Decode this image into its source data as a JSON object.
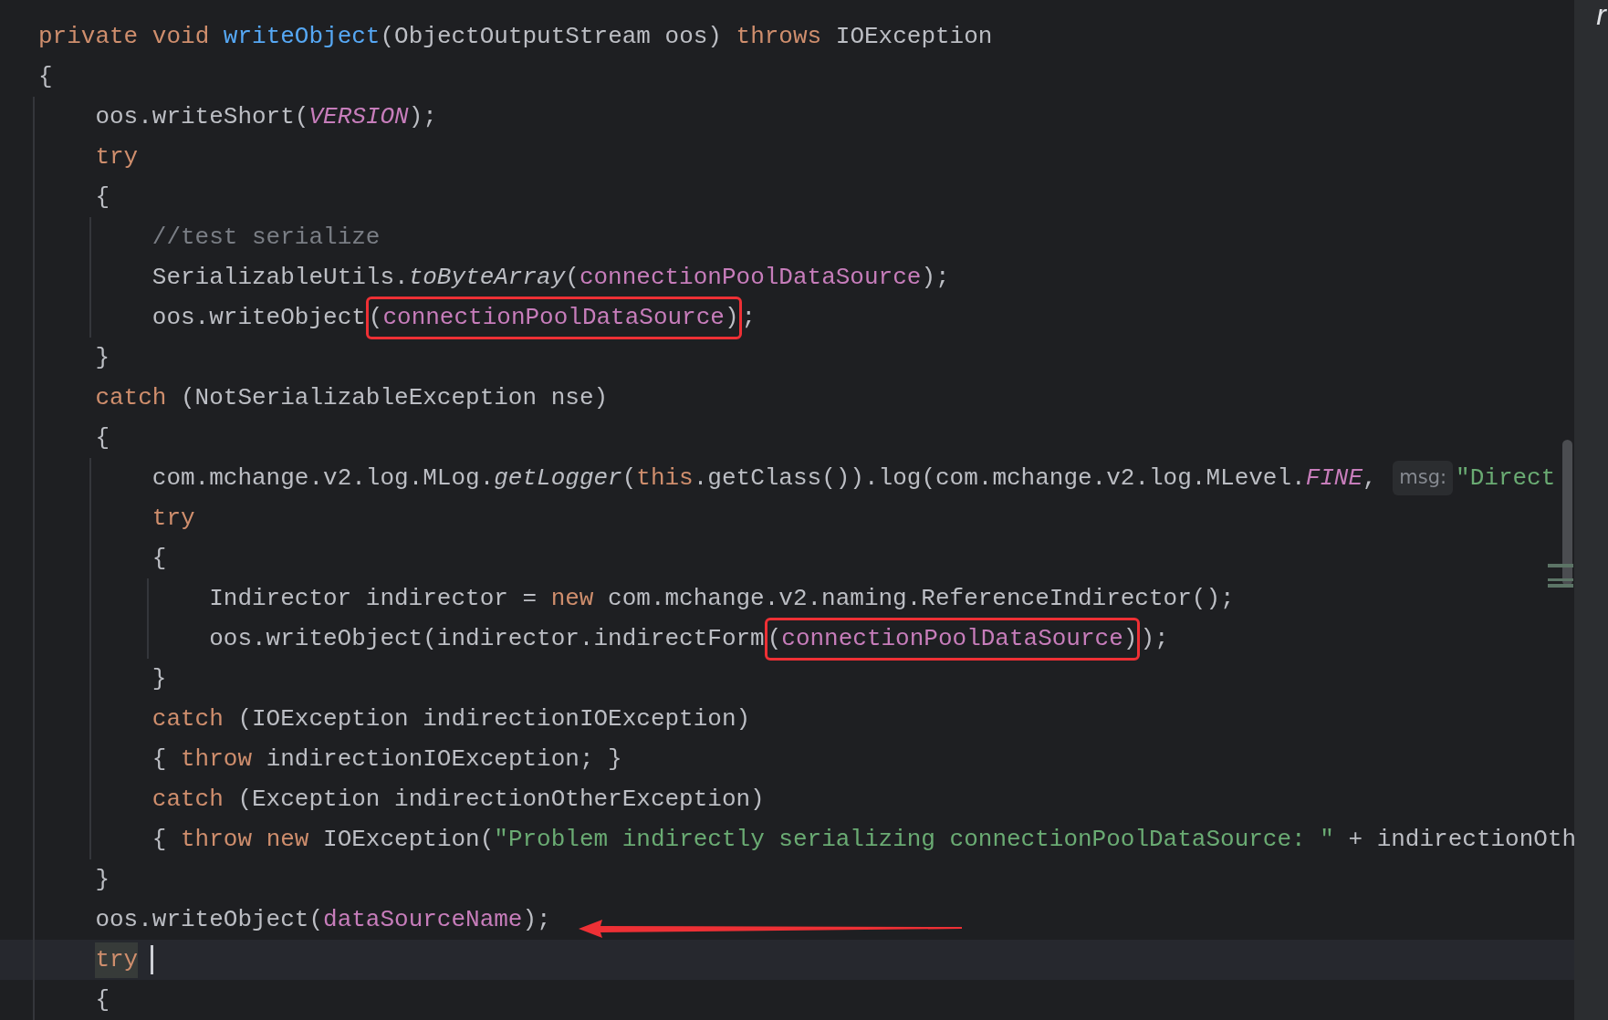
{
  "editor": {
    "lines": [
      {
        "tokens": [
          {
            "kind": "keyword",
            "t": "private void "
          },
          {
            "kind": "method",
            "t": "writeObject"
          },
          {
            "kind": "plain",
            "t": "(ObjectOutputStream oos) "
          },
          {
            "kind": "keyword",
            "t": "throws"
          },
          {
            "kind": "plain",
            "t": " IOException"
          }
        ]
      },
      {
        "tokens": [
          {
            "kind": "plain",
            "t": "{"
          }
        ],
        "children": [
          {
            "tokens": [
              {
                "kind": "plain",
                "t": "oos.writeShort("
              },
              {
                "kind": "constant",
                "t": "VERSION"
              },
              {
                "kind": "plain",
                "t": ");"
              }
            ]
          },
          {
            "tokens": [
              {
                "kind": "keyword",
                "t": "try"
              }
            ]
          },
          {
            "tokens": [
              {
                "kind": "plain",
                "t": "{"
              }
            ],
            "children": [
              {
                "tokens": [
                  {
                    "kind": "comment",
                    "t": "//test serialize"
                  }
                ]
              },
              {
                "tokens": [
                  {
                    "kind": "plain",
                    "t": "SerializableUtils."
                  },
                  {
                    "kind": "static",
                    "t": "toByteArray"
                  },
                  {
                    "kind": "plain",
                    "t": "("
                  },
                  {
                    "kind": "field",
                    "t": "connectionPoolDataSource"
                  },
                  {
                    "kind": "plain",
                    "t": ");"
                  }
                ]
              },
              {
                "tokens": [
                  {
                    "kind": "plain",
                    "t": "oos.writeObject"
                  },
                  {
                    "kind": "boxed",
                    "parts": [
                      {
                        "kind": "plain",
                        "t": "("
                      },
                      {
                        "kind": "field",
                        "t": "connectionPoolDataSource"
                      },
                      {
                        "kind": "plain",
                        "t": ")"
                      }
                    ]
                  },
                  {
                    "kind": "plain",
                    "t": ";"
                  }
                ]
              }
            ]
          },
          {
            "tokens": [
              {
                "kind": "plain",
                "t": "}"
              }
            ]
          },
          {
            "tokens": [
              {
                "kind": "keyword",
                "t": "catch"
              },
              {
                "kind": "plain",
                "t": " (NotSerializableException nse)"
              }
            ]
          },
          {
            "tokens": [
              {
                "kind": "plain",
                "t": "{"
              }
            ],
            "children": [
              {
                "tokens": [
                  {
                    "kind": "plain",
                    "t": "com.mchange.v2.log.MLog."
                  },
                  {
                    "kind": "static",
                    "t": "getLogger"
                  },
                  {
                    "kind": "plain",
                    "t": "("
                  },
                  {
                    "kind": "keyword",
                    "t": "this"
                  },
                  {
                    "kind": "plain",
                    "t": ".getClass()).log(com.mchange.v2.log.MLevel."
                  },
                  {
                    "kind": "constant",
                    "t": "FINE"
                  },
                  {
                    "kind": "plain",
                    "t": ", "
                  },
                  {
                    "kind": "hint",
                    "t": "msg:"
                  },
                  {
                    "kind": "string",
                    "t": "\"Direct"
                  }
                ]
              },
              {
                "tokens": [
                  {
                    "kind": "keyword",
                    "t": "try"
                  }
                ]
              },
              {
                "tokens": [
                  {
                    "kind": "plain",
                    "t": "{"
                  }
                ],
                "children": [
                  {
                    "tokens": [
                      {
                        "kind": "plain",
                        "t": "Indirector indirector = "
                      },
                      {
                        "kind": "keyword",
                        "t": "new"
                      },
                      {
                        "kind": "plain",
                        "t": " com.mchange.v2.naming.ReferenceIndirector();"
                      }
                    ]
                  },
                  {
                    "tokens": [
                      {
                        "kind": "plain",
                        "t": "oos.writeObject(indirector.indirectForm"
                      },
                      {
                        "kind": "boxed",
                        "parts": [
                          {
                            "kind": "plain",
                            "t": "("
                          },
                          {
                            "kind": "field",
                            "t": "connectionPoolDataSource"
                          },
                          {
                            "kind": "plain",
                            "t": ")"
                          }
                        ]
                      },
                      {
                        "kind": "plain",
                        "t": ");"
                      }
                    ]
                  }
                ]
              },
              {
                "tokens": [
                  {
                    "kind": "plain",
                    "t": "}"
                  }
                ]
              },
              {
                "tokens": [
                  {
                    "kind": "keyword",
                    "t": "catch"
                  },
                  {
                    "kind": "plain",
                    "t": " (IOException indirectionIOException)"
                  }
                ]
              },
              {
                "tokens": [
                  {
                    "kind": "plain",
                    "t": "{ "
                  },
                  {
                    "kind": "keyword",
                    "t": "throw"
                  },
                  {
                    "kind": "plain",
                    "t": " indirectionIOException; }"
                  }
                ]
              },
              {
                "tokens": [
                  {
                    "kind": "keyword",
                    "t": "catch"
                  },
                  {
                    "kind": "plain",
                    "t": " (Exception indirectionOtherException)"
                  }
                ]
              },
              {
                "tokens": [
                  {
                    "kind": "plain",
                    "t": "{ "
                  },
                  {
                    "kind": "keyword",
                    "t": "throw new"
                  },
                  {
                    "kind": "plain",
                    "t": " IOException("
                  },
                  {
                    "kind": "string",
                    "t": "\"Problem indirectly serializing connectionPoolDataSource: \""
                  },
                  {
                    "kind": "plain",
                    "t": " + indirectionOth"
                  }
                ]
              }
            ]
          },
          {
            "tokens": [
              {
                "kind": "plain",
                "t": "}"
              }
            ]
          },
          {
            "arrow": true,
            "tokens": [
              {
                "kind": "plain",
                "t": "oos.writeObject("
              },
              {
                "kind": "field",
                "t": "dataSourceName"
              },
              {
                "kind": "plain",
                "t": ");"
              }
            ]
          },
          {
            "current": true,
            "caret": true,
            "tokens": [
              {
                "kind": "keyword",
                "t": "try",
                "highlighted": true
              }
            ]
          },
          {
            "tokens": [
              {
                "kind": "plain",
                "t": "{"
              }
            ]
          }
        ]
      }
    ]
  },
  "side_panel": {
    "text": "r"
  }
}
